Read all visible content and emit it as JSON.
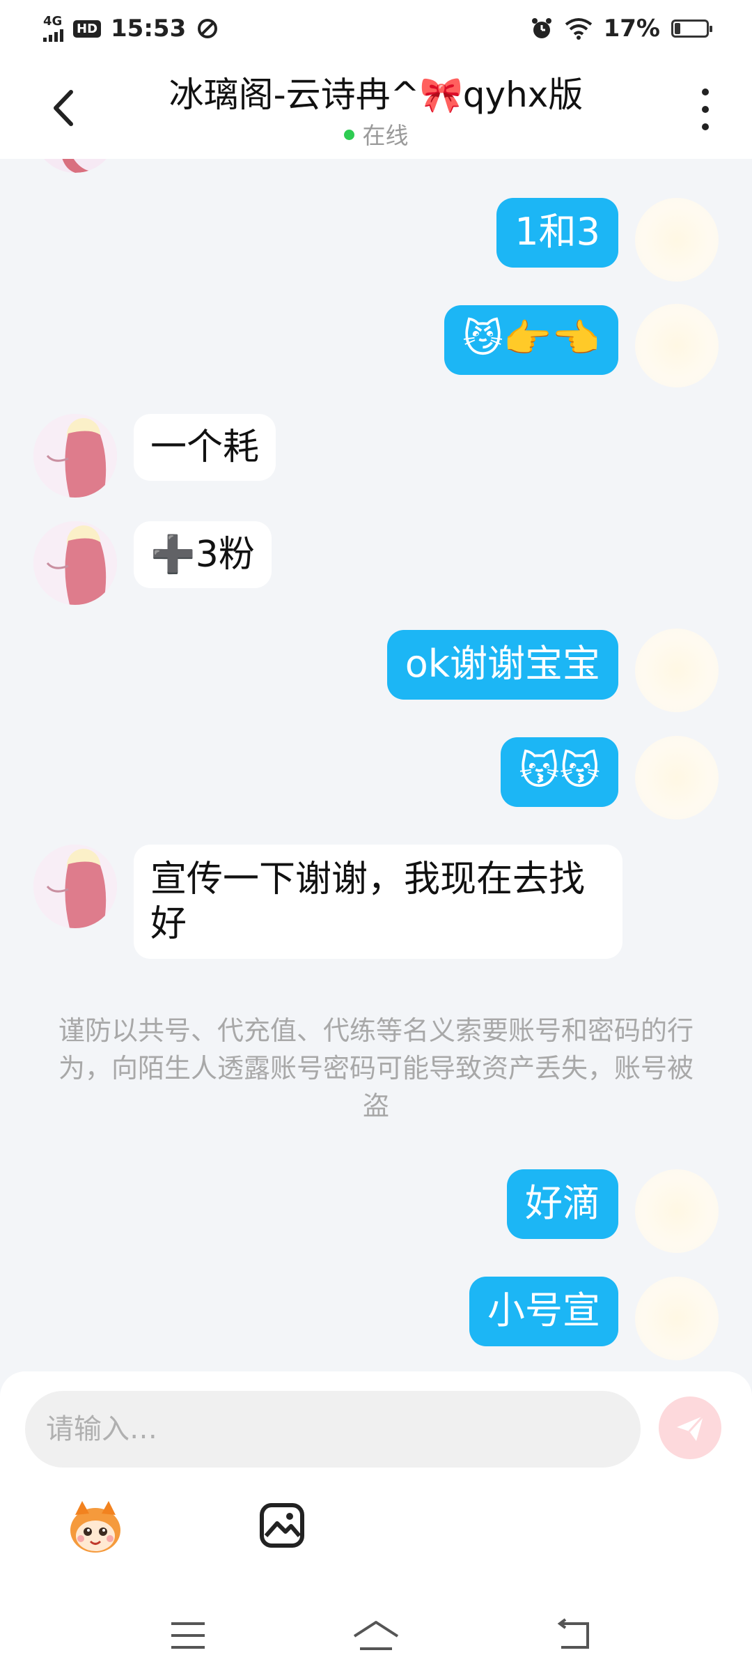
{
  "status_bar": {
    "network": "4G",
    "hd": "HD",
    "time": "15:53",
    "battery_percent": "17%",
    "battery_level": 0.17
  },
  "header": {
    "title": "冰璃阁-云诗冉^🎀qyhx版",
    "status": "在线",
    "status_color": "#2ecc52"
  },
  "messages": [
    {
      "side": "out",
      "text": "1和3"
    },
    {
      "side": "out",
      "text": "😼👉👈"
    },
    {
      "side": "in",
      "text": "一个耗"
    },
    {
      "side": "in",
      "text": "➕3粉"
    },
    {
      "side": "out",
      "text": "ok谢谢宝宝"
    },
    {
      "side": "out",
      "text": "😽😽"
    },
    {
      "side": "in",
      "text": "宣传一下谢谢，我现在去找好"
    },
    {
      "side": "notice",
      "text": "谨防以共号、代充值、代练等名义索要账号和密码的行为，向陌生人透露账号密码可能导致资产丢失，账号被盗"
    },
    {
      "side": "out",
      "text": "好滴"
    },
    {
      "side": "out",
      "text": "小号宣"
    }
  ],
  "composer": {
    "placeholder": "请输入…",
    "send_icon": "paper-plane-icon",
    "emoji_icon": "mascot-emoji-icon",
    "image_icon": "image-icon"
  },
  "nav": {
    "menu_icon": "menu-icon",
    "home_icon": "home-icon",
    "back_icon": "back-arrow-icon"
  },
  "colors": {
    "outgoing_bubble": "#1cb6f5",
    "incoming_bubble": "#ffffff",
    "background": "#f3f5f8",
    "send_button": "#fdd9dc"
  }
}
